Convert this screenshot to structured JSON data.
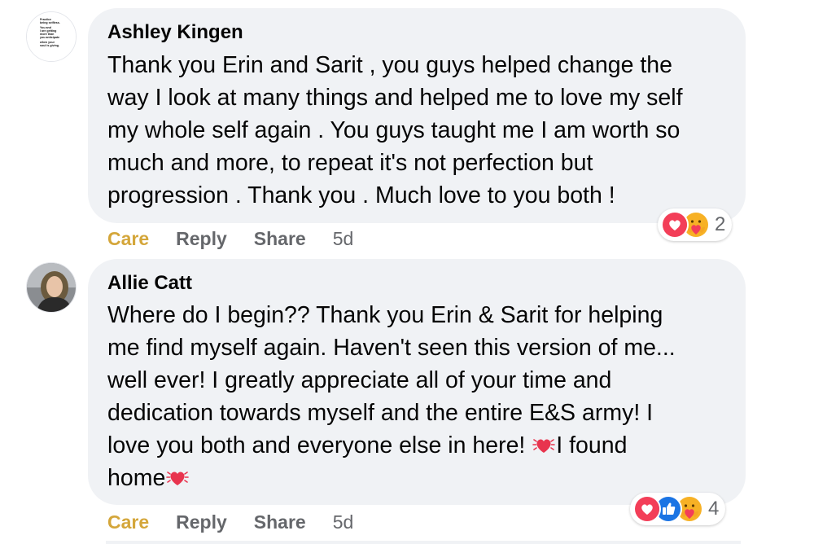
{
  "comments": [
    {
      "author": "Ashley Kingen",
      "avatar_text": [
        "Practice",
        "being selfless.",
        "You and",
        "I are getting",
        "more than",
        "you anticipate",
        "when your",
        "soul is giving."
      ],
      "lines": [
        "Thank you Erin and Sarit , you guys helped change the",
        "way I look at many things and helped me to love my self",
        "my whole self again . You guys taught me I am worth so",
        "much and more, to repeat it's not perfection but",
        "progression . Thank you . Much love to you both !"
      ],
      "actions": {
        "care": "Care",
        "reply": "Reply",
        "share": "Share",
        "time": "5d"
      },
      "reactions": {
        "icons": [
          "love-icon",
          "care-icon"
        ],
        "count": "2"
      }
    },
    {
      "author": "Allie Catt",
      "lines": [
        "Where do I begin?? Thank you Erin & Sarit for helping",
        "me find myself again. Haven't seen this version of me...",
        "well ever! I greatly appreciate all of your time and",
        "dedication towards myself and the entire E&S army! I",
        "love you both and everyone else in here! ",
        "home"
      ],
      "line5_tail": "I found",
      "actions": {
        "care": "Care",
        "reply": "Reply",
        "share": "Share",
        "time": "5d"
      },
      "reactions": {
        "icons": [
          "love-icon",
          "like-icon",
          "care-icon"
        ],
        "count": "4"
      }
    }
  ],
  "colors": {
    "bubble": "#f0f2f5",
    "care_active": "#d4a63a",
    "meta": "#65676b",
    "love": "#f33e58",
    "like": "#1b74e4",
    "care_face": "#f7b125"
  }
}
